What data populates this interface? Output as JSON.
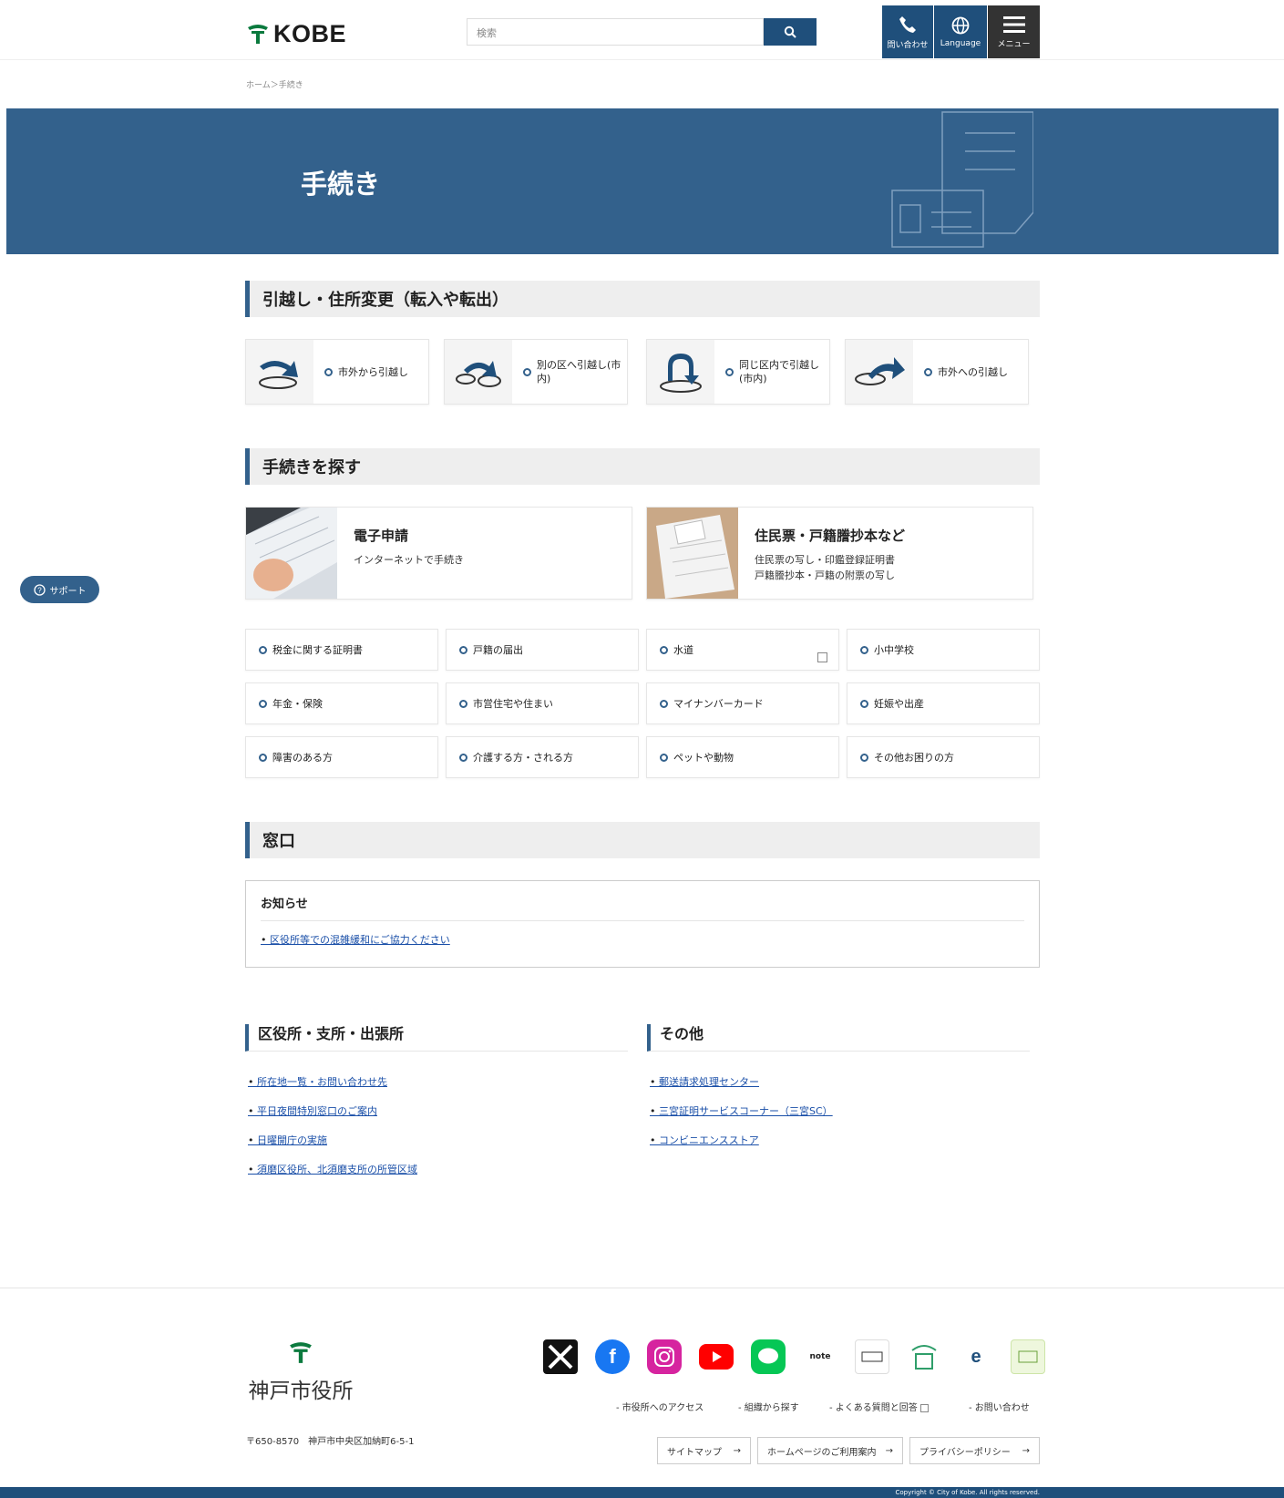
{
  "header": {
    "logo_text": "KOBE",
    "search_placeholder": "検索",
    "tel_label": "問い合わせ",
    "lang_label": "Language",
    "menu_label": "メニュー"
  },
  "breadcrumb": "ホーム＞手続き",
  "hero": {
    "title": "手続き"
  },
  "sections": {
    "moving": "引越し・住所変更（転入や転出）",
    "search": "手続きを探す",
    "counter": "窓口"
  },
  "moving_cards": [
    {
      "label": "市外から引越し"
    },
    {
      "label": "別の区へ引越し(市内)"
    },
    {
      "label": "同じ区内で引越し(市内)"
    },
    {
      "label": "市外への引越し"
    }
  ],
  "feature_cards": [
    {
      "title": "電子申請",
      "desc": "インターネットで手続き"
    },
    {
      "title": "住民票・戸籍謄抄本など",
      "desc": "住民票の写し・印鑑登録証明書\n戸籍謄抄本・戸籍の附票の写し"
    }
  ],
  "grid_links": [
    "税金に関する証明書",
    "戸籍の届出",
    "水道",
    "小中学校",
    "年金・保険",
    "市営住宅や住まい",
    "マイナンバーカード",
    "妊娠や出産",
    "障害のある方",
    "介護する方・される方",
    "ペットや動物",
    "その他お困りの方"
  ],
  "notice": {
    "title": "お知らせ",
    "link": "区役所等での混雑緩和にご協力ください"
  },
  "offices": {
    "title": "区役所・支所・出張所",
    "links": [
      "所在地一覧・お問い合わせ先",
      "平日夜間特別窓口のご案内",
      "日曜開庁の実施",
      "須磨区役所、北須磨支所の所管区域"
    ]
  },
  "others": {
    "title": "その他",
    "links": [
      "郵送請求処理センター",
      "三宮証明サービスコーナー（三宮SC）",
      "コンビニエンスストア"
    ]
  },
  "support_label": "サポート",
  "footer": {
    "logo_text": "神戸市役所",
    "address": "〒650-8570　神戸市中央区加納町6-5-1",
    "nav": [
      "市役所へのアクセス",
      "組織から探す",
      "よくある質問と回答",
      "お問い合わせ"
    ],
    "buttons": [
      "サイトマップ",
      "ホームページのご利用案内",
      "プライバシーポリシー"
    ],
    "sns": [
      "x-icon",
      "facebook-icon",
      "instagram-icon",
      "youtube-icon",
      "line-icon",
      "note-icon",
      "ichibe-icon",
      "smart-kobe-icon",
      "e-kobe-icon",
      "kobe-app-icon"
    ],
    "copyright": "Copyright © City of Kobe. All rights reserved."
  },
  "colors": {
    "primary": "#33618c",
    "dark": "#1f4f7b",
    "green": "#0b7a3e",
    "link": "#1a4fa8"
  }
}
